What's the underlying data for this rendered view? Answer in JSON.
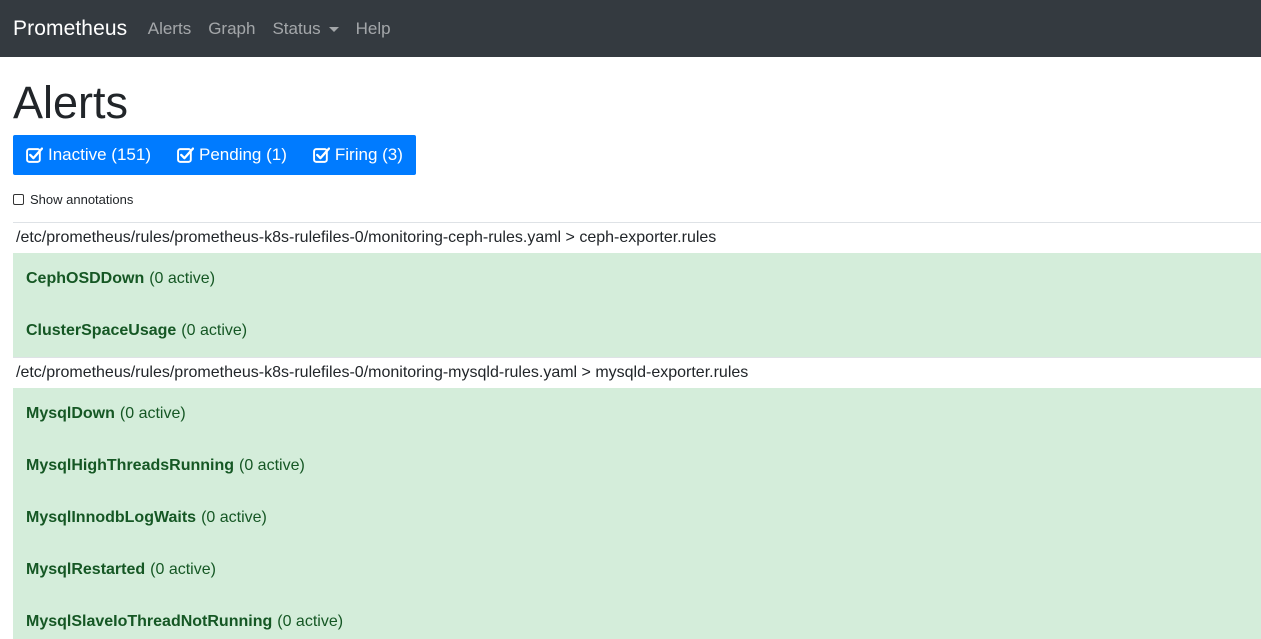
{
  "navbar": {
    "brand": "Prometheus",
    "items": [
      {
        "label": "Alerts"
      },
      {
        "label": "Graph"
      },
      {
        "label": "Status"
      },
      {
        "label": "Help"
      }
    ]
  },
  "page": {
    "title": "Alerts",
    "filters": [
      {
        "label": "Inactive (151)",
        "icon": "checkbox-checked-icon"
      },
      {
        "label": "Pending (1)",
        "icon": "checkbox-checked-icon"
      },
      {
        "label": "Firing (3)",
        "icon": "checkbox-checked-icon"
      }
    ],
    "show_annotations": "Show annotations"
  },
  "groups": [
    {
      "header": "/etc/prometheus/rules/prometheus-k8s-rulefiles-0/monitoring-ceph-rules.yaml > ceph-exporter.rules",
      "rules": [
        {
          "name": "CephOSDDown",
          "count": "(0 active)"
        },
        {
          "name": "ClusterSpaceUsage",
          "count": "(0 active)"
        }
      ]
    },
    {
      "header": "/etc/prometheus/rules/prometheus-k8s-rulefiles-0/monitoring-mysqld-rules.yaml > mysqld-exporter.rules",
      "rules": [
        {
          "name": "MysqlDown",
          "count": "(0 active)"
        },
        {
          "name": "MysqlHighThreadsRunning",
          "count": "(0 active)"
        },
        {
          "name": "MysqlInnodbLogWaits",
          "count": "(0 active)"
        },
        {
          "name": "MysqlRestarted",
          "count": "(0 active)"
        },
        {
          "name": "MysqlSlaveIoThreadNotRunning",
          "count": "(0 active)"
        }
      ]
    }
  ],
  "colors": {
    "navbar_bg": "#343a40",
    "primary": "#007bff",
    "success_bg": "#d4edda",
    "success_text": "#155724"
  }
}
